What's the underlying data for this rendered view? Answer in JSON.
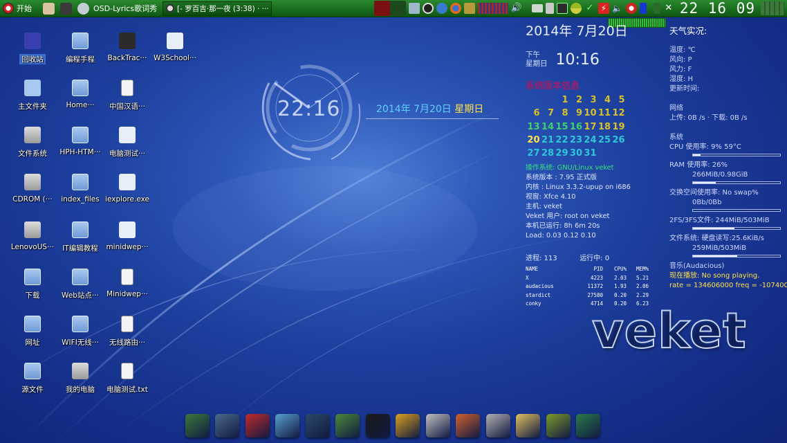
{
  "panel": {
    "start_label": "开始",
    "app_label": "OSD-Lyrics歌词秀",
    "task_label": "[- 罗百吉·那一夜 (3:38) · ···",
    "clock": "22 16 09"
  },
  "desktop_icons": [
    {
      "label": "回收站",
      "kind": "trash",
      "selected": true
    },
    {
      "label": "编程手程",
      "kind": "folder"
    },
    {
      "label": "BackTrac···",
      "kind": "image"
    },
    {
      "label": "W3School···",
      "kind": "app"
    },
    {
      "label": "主文件夹",
      "kind": "home"
    },
    {
      "label": "Home···",
      "kind": "folder"
    },
    {
      "label": "中国汉语···",
      "kind": "doc"
    },
    {
      "label": "文件系统",
      "kind": "drive"
    },
    {
      "label": "HPH-HTM···",
      "kind": "folder"
    },
    {
      "label": "电脑测试···",
      "kind": "app"
    },
    {
      "label": "CDROM (···",
      "kind": "drive"
    },
    {
      "label": "index_files",
      "kind": "folder"
    },
    {
      "label": "iexplore.exe",
      "kind": "app"
    },
    {
      "label": "LenovoUS···",
      "kind": "drive"
    },
    {
      "label": "IT编辑教程",
      "kind": "folder"
    },
    {
      "label": "minidwep···",
      "kind": "app"
    },
    {
      "label": "下载",
      "kind": "folder"
    },
    {
      "label": "Web站点···",
      "kind": "folder"
    },
    {
      "label": "Minidwep···",
      "kind": "doc"
    },
    {
      "label": "网址",
      "kind": "folder"
    },
    {
      "label": "WIFI无线···",
      "kind": "folder"
    },
    {
      "label": "无线路由···",
      "kind": "doc"
    },
    {
      "label": "源文件",
      "kind": "folder"
    },
    {
      "label": "我的电脑",
      "kind": "drive"
    },
    {
      "label": "电脑测试.txt",
      "kind": "txt"
    }
  ],
  "desktop_clock": {
    "time": "22:16",
    "date": "2014年 7月20日",
    "weekday": "星期日"
  },
  "conky": {
    "date": "2014年 7月20日",
    "ampm": "下午",
    "weekday": "星期日",
    "time": "10:16",
    "calendar_title": "系统版本信息",
    "calendar_rows": [
      [
        "",
        "",
        "1",
        "2",
        "3",
        "4",
        "5"
      ],
      [
        "6",
        "7",
        "8",
        "9",
        "10",
        "11",
        "12"
      ],
      [
        "13",
        "14",
        "15",
        "16",
        "17",
        "18",
        "19"
      ],
      [
        "20",
        "21",
        "22",
        "23",
        "24",
        "25",
        "26"
      ],
      [
        "27",
        "28",
        "29",
        "30",
        "31",
        "",
        ""
      ]
    ],
    "sys": {
      "os": "操作系统: GNU/Linux veket",
      "version": "系统版本 : 7.95 正式版",
      "kernel": "内核 : Linux 3.3.2-upup on i686",
      "wm": "视窗: Xfce 4.10",
      "host": "主机: veket",
      "user": "Veket 用户: root on  veket",
      "uptime": "本机已运行: 8h 6m 20s",
      "load": "Load: 0.03 0.12 0.10"
    },
    "procs": "进程: 113",
    "running": "运行中: 0",
    "table_headers": [
      "NAME",
      "PID",
      "CPU%",
      "MEM%"
    ],
    "table_rows": [
      [
        "X",
        "4223",
        "2.03",
        "5.21"
      ],
      [
        "audacious",
        "11372",
        "1.93",
        "2.06"
      ],
      [
        "stardict",
        "27580",
        "0.20",
        "2.29"
      ],
      [
        "conky",
        "4714",
        "0.20",
        "6.23"
      ]
    ]
  },
  "right": {
    "weather_title": "天气实况:",
    "temp": "温度: ℃",
    "wind_dir": "风向: P",
    "wind_force": "风力: F",
    "humidity": "湿度: H",
    "updated": "更新时间:",
    "net_title": "网络",
    "net": "上传: 0B /s · 下载: 0B /s",
    "sys_title": "系统",
    "cpu": "CPU 使用率: 9%     59°C",
    "cpu_frac": 0.09,
    "ram": "RAM 使用率: 26%",
    "ram_detail": "266MiB/0.98GiB",
    "ram_frac": 0.26,
    "swap": "交换空间使用率: No swap%",
    "swap_detail": "0Bb/0Bb",
    "swap_frac": 0,
    "fs2": "2FS/3FS文件: 244MiB/503MiB",
    "fs2_frac": 0.48,
    "fs": "文件系统:      硬盘读写:25.6KiB/s",
    "fs_detail": "259MiB/503MiB",
    "fs_frac": 0.51,
    "music_title": "音乐(Audacious)",
    "music_status": "现在播放: No song playing.",
    "music_rate": "rate = 134606000 freq = -107400"
  },
  "logo": "veket",
  "dock": [
    "terminal",
    "monitor",
    "game",
    "draw",
    "media",
    "network",
    "qq",
    "folder",
    "image-viewer",
    "paint",
    "usb",
    "photos",
    "help",
    "system"
  ],
  "colors": {
    "panel": "#1b7a1f",
    "accent": "#5fd0ff",
    "calendar_title": "#9c1f6e",
    "highlight": "#ffe14a"
  }
}
